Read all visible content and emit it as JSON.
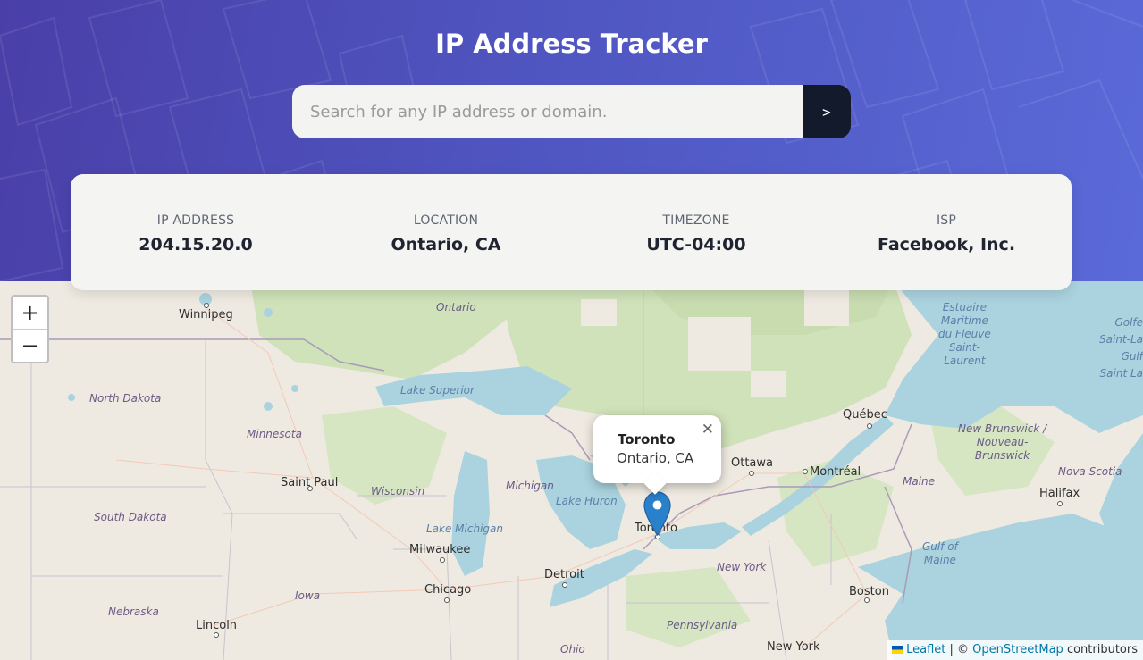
{
  "header": {
    "title": "IP Address Tracker",
    "search_placeholder": "Search for any IP address or domain.",
    "search_value": "",
    "submit_label": ">"
  },
  "info": {
    "ip_label": "IP ADDRESS",
    "ip_value": "204.15.20.0",
    "location_label": "LOCATION",
    "location_value": "Ontario, CA",
    "timezone_label": "TIMEZONE",
    "timezone_value": "UTC-04:00",
    "isp_label": "ISP",
    "isp_value": "Facebook, Inc."
  },
  "map": {
    "zoom_in": "+",
    "zoom_out": "−",
    "popup": {
      "title": "Toronto",
      "subtitle": "Ontario, CA",
      "close": "✕"
    },
    "attribution": {
      "leaflet": "Leaflet",
      "separator": " | © ",
      "osm": "OpenStreetMap",
      "suffix": " contributors"
    },
    "labels": {
      "winnipeg": "Winnipeg",
      "ontario": "Ontario",
      "north_dakota": "North Dakota",
      "minnesota": "Minnesota",
      "south_dakota": "South Dakota",
      "nebraska": "Nebraska",
      "iowa": "Iowa",
      "wisconsin": "Wisconsin",
      "saint_paul": "Saint Paul",
      "milwaukee": "Milwaukee",
      "chicago": "Chicago",
      "lincoln": "Lincoln",
      "michigan": "Michigan",
      "lake_michigan": "Lake Michigan",
      "lake_superior": "Lake Superior",
      "lake_huron": "Lake Huron",
      "detroit": "Detroit",
      "toronto": "Toronto",
      "ottawa": "Ottawa",
      "montreal": "Montréal",
      "quebec": "Québec",
      "new_york_state": "New York",
      "new_york_city": "New York",
      "boston": "Boston",
      "pennsylvania": "Pennsylvania",
      "ohio": "Ohio",
      "maine": "Maine",
      "gulf_of_maine": "Gulf of\nMaine",
      "new_brunswick": "New Brunswick /\nNouveau-\nBrunswick",
      "nova_scotia": "Nova Scotia",
      "halifax": "Halifax",
      "estuaire": "Estuaire\nMaritime\ndu Fleuve\nSaint-\nLaurent",
      "golfe": "Golfe\nSaint-La\nGulf\nSaint La"
    }
  },
  "colors": {
    "header_gradient_start": "#4a3fa8",
    "header_gradient_end": "#5a6ad8",
    "submit_bg": "#121a2b",
    "marker": "#2a81cb",
    "water": "#aad3df"
  }
}
